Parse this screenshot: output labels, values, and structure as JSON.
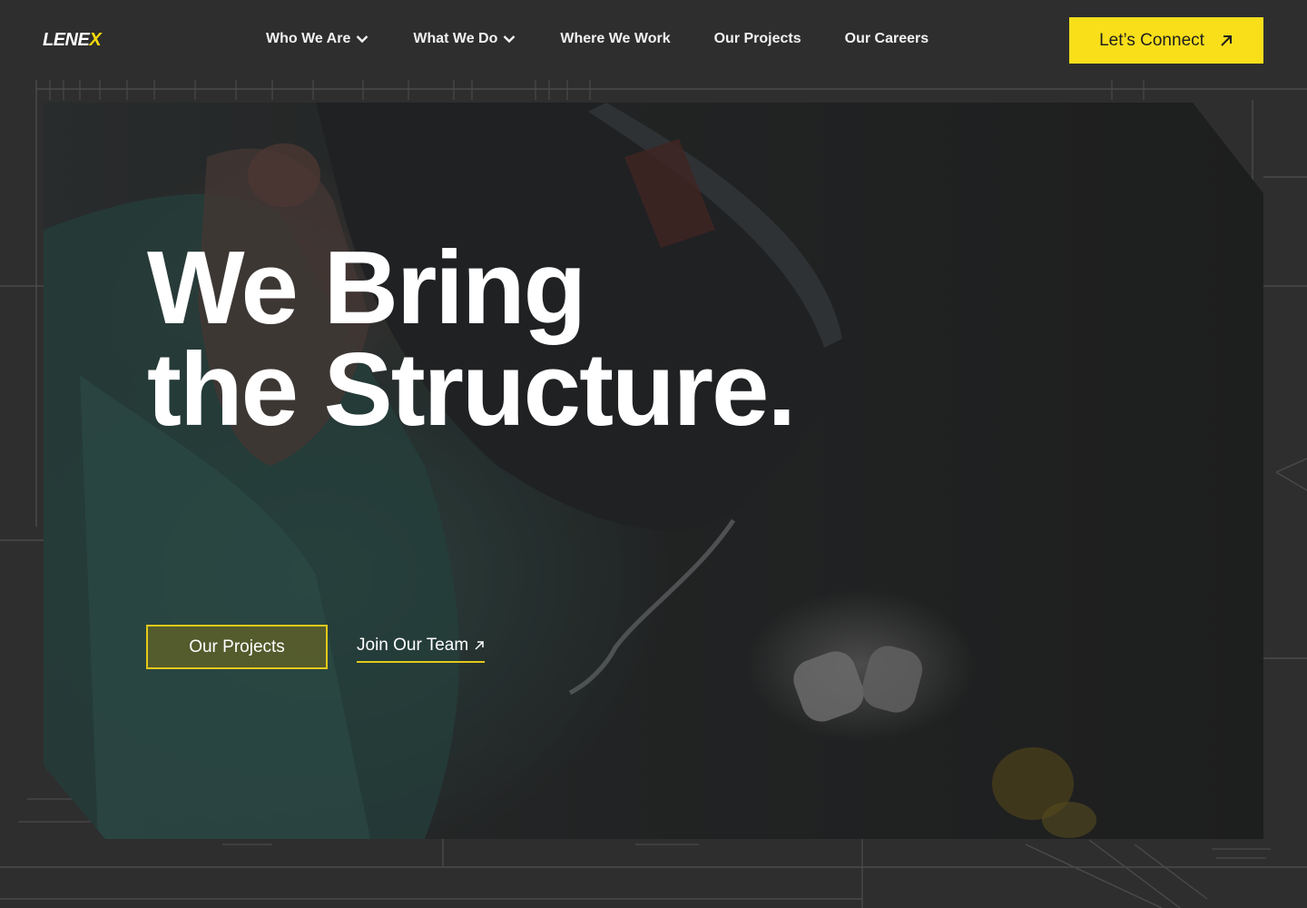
{
  "brand": {
    "logo_main": "LENE",
    "logo_accent": "X"
  },
  "nav": {
    "items": [
      {
        "label": "Who We Are",
        "has_dropdown": true
      },
      {
        "label": "What We Do",
        "has_dropdown": true
      },
      {
        "label": "Where We Work",
        "has_dropdown": false
      },
      {
        "label": "Our Projects",
        "has_dropdown": false
      },
      {
        "label": "Our Careers",
        "has_dropdown": false
      }
    ],
    "cta_label": "Let’s Connect"
  },
  "hero": {
    "headline_line1": "We Bring",
    "headline_line2": "the Structure.",
    "primary_button": "Our Projects",
    "secondary_link": "Join Our Team"
  },
  "colors": {
    "accent": "#f8df1a",
    "background": "#2e2e2e",
    "text": "#ffffff"
  },
  "icons": {
    "dropdown": "chevron-down-icon",
    "external": "arrow-up-right-icon"
  }
}
